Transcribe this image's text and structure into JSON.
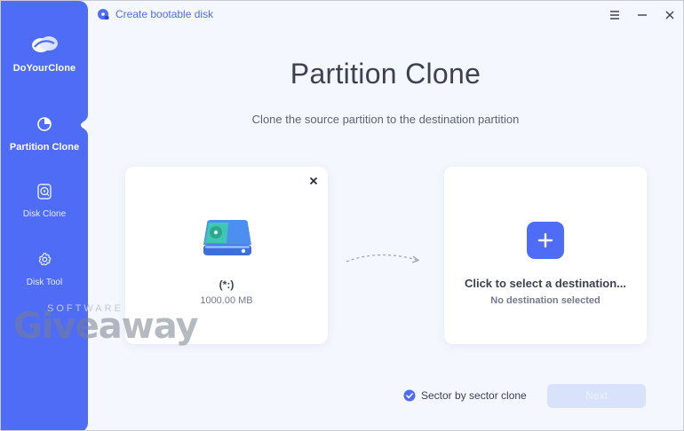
{
  "app": {
    "name": "DoYourClone"
  },
  "titlebar": {
    "create_bootable_label": "Create bootable disk"
  },
  "sidebar": {
    "items": [
      {
        "label": "Partition Clone",
        "icon": "pie-chart-icon",
        "active": true
      },
      {
        "label": "Disk Clone",
        "icon": "disk-clone-icon",
        "active": false
      },
      {
        "label": "Disk Tool",
        "icon": "gear-icon",
        "active": false
      }
    ]
  },
  "main": {
    "title": "Partition Clone",
    "subtitle": "Clone the source partition to the destination partition",
    "source": {
      "name": "(*:)",
      "size": "1000.00 MB"
    },
    "destination": {
      "prompt": "Click to select a destination...",
      "status": "No destination selected"
    }
  },
  "footer": {
    "sector_clone_label": "Sector by sector clone",
    "sector_clone_checked": true,
    "next_label": "Next",
    "next_enabled": false
  },
  "watermark": {
    "top": "SOFTWARE",
    "main": "Giveaway"
  },
  "colors": {
    "accent": "#4f6cf6",
    "background": "#f4f7fd",
    "text": "#3d4250",
    "muted": "#737a8a"
  }
}
